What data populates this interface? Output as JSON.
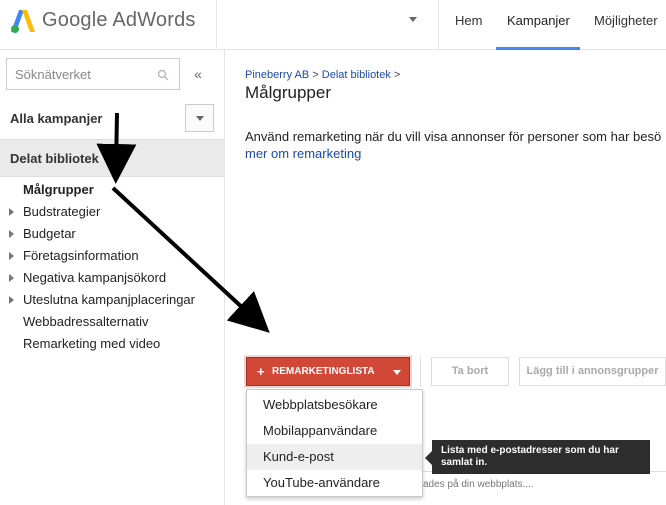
{
  "header": {
    "brand": "Google AdWords",
    "nav": [
      {
        "label": "Hem"
      },
      {
        "label": "Kampanjer"
      },
      {
        "label": "Möjligheter"
      }
    ],
    "accent": "#4285f4"
  },
  "sidebar": {
    "search_placeholder": "Söknätverket",
    "all_campaigns": "Alla kampanjer",
    "shared_library": "Delat bibliotek",
    "items": [
      {
        "label": "Målgrupper"
      },
      {
        "label": "Budstrategier"
      },
      {
        "label": "Budgetar"
      },
      {
        "label": "Företagsinformation"
      },
      {
        "label": "Negativa kampanjsökord"
      },
      {
        "label": "Uteslutna kampanjplaceringar"
      },
      {
        "label": "Webbadressalternativ"
      },
      {
        "label": "Remarketing med video"
      }
    ]
  },
  "main": {
    "breadcrumb": {
      "account": "Pineberry AB",
      "separator": ">",
      "library": "Delat bibliotek",
      "trailing": ">"
    },
    "title": "Målgrupper",
    "description": "Använd remarketing när du vill visa annonser för personer som har besö",
    "learn_more": "mer om remarketing",
    "toolbar": {
      "remarketing_label": "REMARKETINGLISTA",
      "delete_label": "Ta bort",
      "add_label": "Lägg till i annonsgrupper"
    },
    "menu": [
      {
        "label": "Webbplatsbesökare"
      },
      {
        "label": "Mobilappanvändare"
      },
      {
        "label": "Kund-e-post"
      },
      {
        "label": "YouTube-användare"
      }
    ],
    "tooltip": "Lista med e-postadresser som du har samlat in.",
    "behind_text": "ades på din webbplats....",
    "brand_red": "#d14836"
  }
}
